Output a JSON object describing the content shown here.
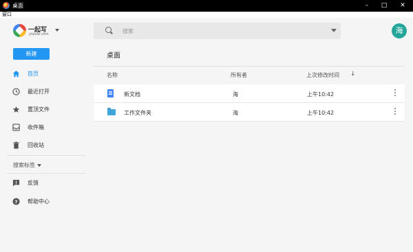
{
  "window": {
    "title": "桌面",
    "menu": "窗口"
  },
  "logo": {
    "brand": "一起写",
    "sub": "yiqixie.com"
  },
  "search": {
    "placeholder": "搜索"
  },
  "user": {
    "avatar_text": "海"
  },
  "new_button": "新建",
  "sidebar": {
    "items": [
      {
        "label": "首页",
        "icon": "home-icon"
      },
      {
        "label": "最近打开",
        "icon": "clock-icon"
      },
      {
        "label": "置顶文件",
        "icon": "star-icon"
      },
      {
        "label": "收件箱",
        "icon": "inbox-icon"
      },
      {
        "label": "回收站",
        "icon": "trash-icon"
      }
    ],
    "tags_label": "搜索标签",
    "footer": [
      {
        "label": "反馈",
        "icon": "feedback-icon"
      },
      {
        "label": "帮助中心",
        "icon": "help-icon"
      }
    ]
  },
  "main": {
    "title": "桌面",
    "columns": {
      "name": "名称",
      "owner": "所有者",
      "modified": "上次修改时间"
    },
    "rows": [
      {
        "name": "新文档",
        "owner": "海",
        "modified": "上午10:42",
        "icon": "document-icon"
      },
      {
        "name": "工作文件夹",
        "owner": "海",
        "modified": "上午10:42",
        "icon": "folder-icon"
      }
    ]
  },
  "colors": {
    "accent": "#2196f3",
    "avatar": "#26a69a",
    "titlebar": "#000000"
  }
}
